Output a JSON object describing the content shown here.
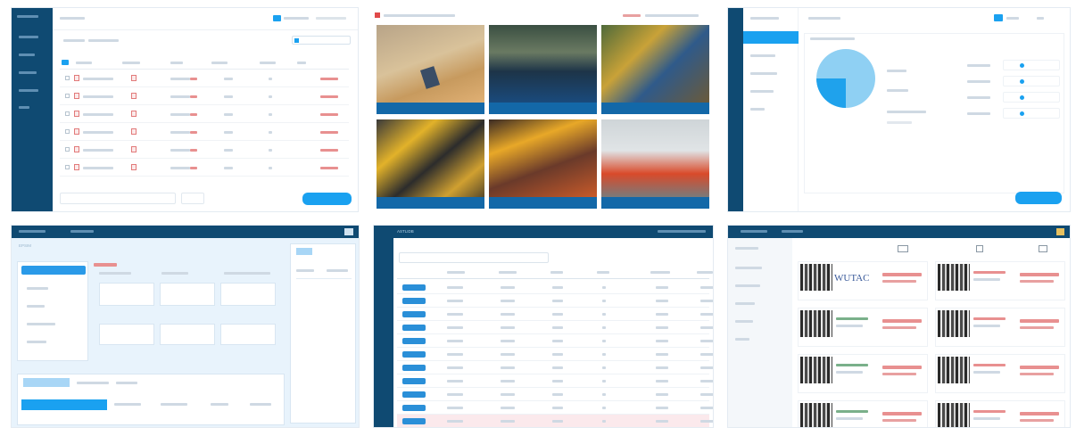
{
  "colors": {
    "navy": "#0f4a72",
    "accent": "#1aa1f0",
    "caption_blue": "#1368a8",
    "alert_red": "#e04a4a",
    "light_panel": "#e8f3fc",
    "pie_light": "#8fd0f3",
    "pie_dark": "#1fa2ec"
  },
  "icons": [
    "document-icon",
    "checkbox-icon",
    "toggle-icon",
    "thumbnail-icon"
  ],
  "panel4": {
    "header_text": "EPSIM"
  },
  "panel5": {
    "header_text": "ASTLIDB"
  },
  "panel6": {
    "thumb_label": "WUTAC"
  }
}
